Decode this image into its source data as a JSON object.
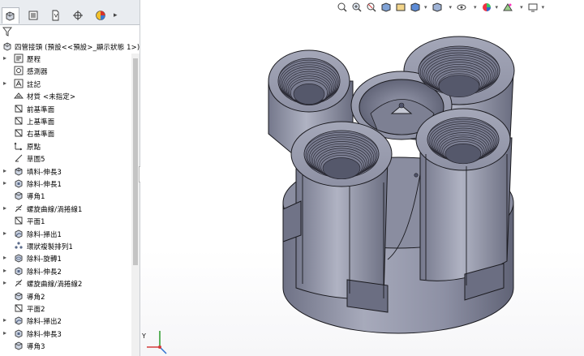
{
  "tabs": [
    {
      "name": "feature-manager",
      "icon": "feature-manager-icon"
    },
    {
      "name": "property-manager",
      "icon": "property-manager-icon"
    },
    {
      "name": "configuration-manager",
      "icon": "configuration-manager-icon"
    },
    {
      "name": "dimxpert-manager",
      "icon": "dimxpert-icon"
    },
    {
      "name": "display-manager",
      "icon": "display-manager-icon"
    }
  ],
  "tree": {
    "root_label": "四管接頭 (預設<<預設>_顯示狀態 1>)",
    "items": [
      {
        "label": "歷程",
        "icon": "history-icon",
        "expand": true
      },
      {
        "label": "感測器",
        "icon": "sensor-icon",
        "expand": false
      },
      {
        "label": "註記",
        "icon": "annotation-icon",
        "expand": true
      },
      {
        "label": "材質 <未指定>",
        "icon": "material-icon",
        "expand": false
      },
      {
        "label": "前基準面",
        "icon": "plane-icon",
        "expand": false
      },
      {
        "label": "上基準面",
        "icon": "plane-icon",
        "expand": false
      },
      {
        "label": "右基準面",
        "icon": "plane-icon",
        "expand": false
      },
      {
        "label": "原點",
        "icon": "origin-icon",
        "expand": false
      },
      {
        "label": "草圖5",
        "icon": "sketch-icon",
        "expand": false
      },
      {
        "label": "填料-伸長3",
        "icon": "boss-extrude-icon",
        "expand": true
      },
      {
        "label": "除料-伸長1",
        "icon": "cut-extrude-icon",
        "expand": true
      },
      {
        "label": "導角1",
        "icon": "chamfer-icon",
        "expand": false
      },
      {
        "label": "螺旋曲線/渦捲線1",
        "icon": "helix-icon",
        "expand": true
      },
      {
        "label": "平面1",
        "icon": "plane-icon",
        "expand": false
      },
      {
        "label": "除料-掃出1",
        "icon": "cut-sweep-icon",
        "expand": true
      },
      {
        "label": "環狀複製排列1",
        "icon": "circular-pattern-icon",
        "expand": false
      },
      {
        "label": "除料-旋轉1",
        "icon": "cut-revolve-icon",
        "expand": true
      },
      {
        "label": "除料-伸長2",
        "icon": "cut-extrude-icon",
        "expand": true
      },
      {
        "label": "螺旋曲線/渦捲線2",
        "icon": "helix-icon",
        "expand": true
      },
      {
        "label": "導角2",
        "icon": "chamfer-icon",
        "expand": false
      },
      {
        "label": "平面2",
        "icon": "plane-icon",
        "expand": false
      },
      {
        "label": "除料-掃出2",
        "icon": "cut-sweep-icon",
        "expand": true
      },
      {
        "label": "除料-伸長3",
        "icon": "cut-extrude-icon",
        "expand": true
      },
      {
        "label": "導角3",
        "icon": "chamfer-icon",
        "expand": false
      }
    ]
  },
  "view_toolbar": [
    "zoom-to-fit-icon",
    "zoom-to-area-icon",
    "previous-view-icon",
    "section-view-icon",
    "dynamic-annotation-icon",
    "view-orientation-icon",
    "display-style-icon",
    "hide-show-items-icon",
    "edit-appearance-icon",
    "apply-scene-icon",
    "view-settings-icon"
  ],
  "triad": {
    "x_label": "X",
    "y_label": "Y",
    "z_label": "Z"
  },
  "colors": {
    "part_body": "#8c8fa3",
    "part_dark": "#5f6275",
    "part_light": "#b3b6c6",
    "edge": "#1a1a1f",
    "panel_bg": "#ffffff",
    "tab_bar": "#e9ecf0"
  }
}
